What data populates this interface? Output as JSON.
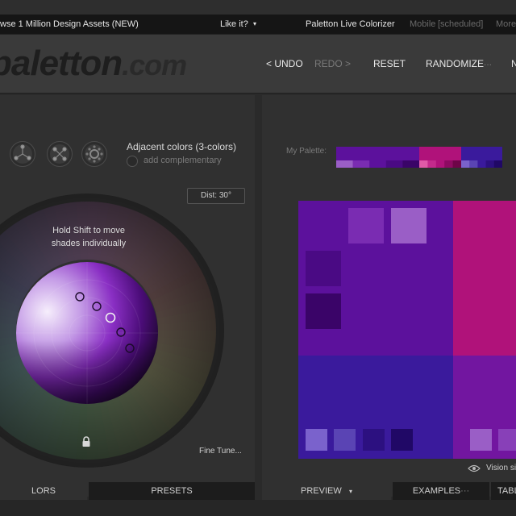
{
  "menubar": {
    "promo": "wse 1 Million Design Assets (NEW)",
    "like": "Like it?",
    "like_caret": "▾",
    "live": "Paletton Live Colorizer",
    "mobile": "Mobile",
    "scheduled": "[scheduled]",
    "more": "More"
  },
  "logo": {
    "main": "paletton",
    "dotcom": ".com"
  },
  "nav": {
    "undo": "< UNDO",
    "redo": "REDO >",
    "reset": "RESET",
    "randomize": "RANDOMIZE",
    "randomize_dots": "···",
    "next": "N"
  },
  "scheme": {
    "title": "Adjacent colors (3-colors)",
    "complement": "add complementary"
  },
  "wheel": {
    "dist": "Dist: 30°",
    "hint_line1": "Hold Shift to move",
    "hint_line2": "shades individually",
    "fine_tune": "Fine Tune..."
  },
  "palette": {
    "label": "My Palette:",
    "primary": "#5c119c",
    "accent": "#b0127a",
    "secondary": "#3a1a9c",
    "primary_shades": [
      "#9a5ec6",
      "#7a2cb2",
      "#5c119c",
      "#4a0a84",
      "#3a0468"
    ],
    "accent_shades": [
      "#e05aa8",
      "#c42a8c",
      "#b0127a",
      "#8e0a62",
      "#6e0448"
    ],
    "secondary_shades": [
      "#7a62cc",
      "#5a44b4",
      "#3a1a9c",
      "#2c1080",
      "#200866"
    ],
    "preview_colors": {
      "purple": "#5c119c",
      "magenta": "#b0127a",
      "indigo": "#3a1a9c",
      "violet": "#7216a0"
    }
  },
  "vision": "Vision si",
  "tabs": {
    "colors": "LORS",
    "presets": "PRESETS",
    "preview": "PREVIEW",
    "preview_caret": "▾",
    "examples": "EXAMPLES",
    "examples_dots": "···",
    "tables": "TABL"
  }
}
